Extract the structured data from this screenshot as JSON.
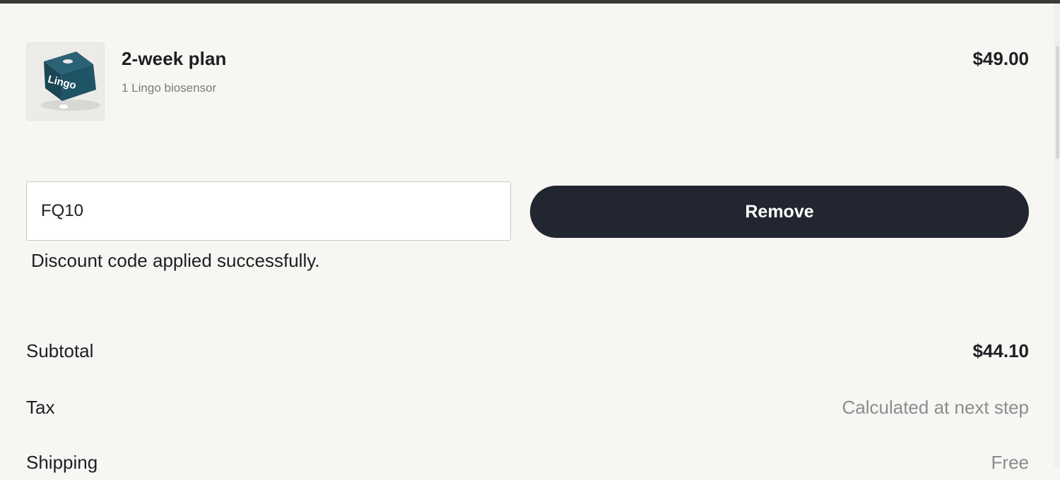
{
  "product": {
    "name": "2-week plan",
    "subtitle": "1 Lingo biosensor",
    "price": "$49.00",
    "thumbnail_brand": "Lingo"
  },
  "discount": {
    "code_value": "FQ10",
    "remove_label": "Remove",
    "message": "Discount code applied successfully."
  },
  "summary": {
    "subtotal_label": "Subtotal",
    "subtotal_value": "$44.10",
    "tax_label": "Tax",
    "tax_value": "Calculated at next step",
    "shipping_label": "Shipping",
    "shipping_value": "Free"
  },
  "colors": {
    "background": "#f7f6f2",
    "button": "#222630",
    "text": "#1d1f24",
    "muted": "#8b8c90",
    "product_box": "#1f4f61"
  }
}
